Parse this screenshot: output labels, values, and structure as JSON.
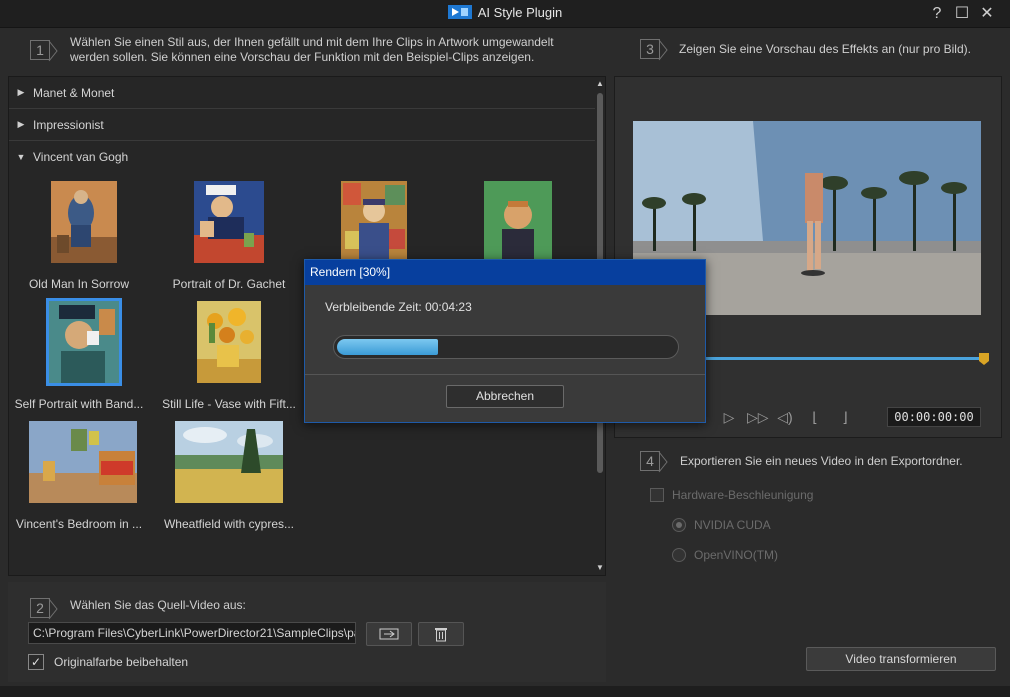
{
  "window": {
    "title": "AI Style Plugin",
    "help": "?",
    "maximize": "☐",
    "close": "✕"
  },
  "steps": {
    "s1": {
      "num": "1",
      "text": "Wählen Sie einen Stil aus, der Ihnen gefällt und mit dem Ihre Clips in Artwork umgewandelt werden sollen. Sie können eine Vorschau der Funktion mit den Beispiel-Clips anzeigen."
    },
    "s2": {
      "num": "2",
      "text": "Wählen Sie das Quell-Video aus:"
    },
    "s3": {
      "num": "3",
      "text": "Zeigen Sie eine Vorschau des Effekts an (nur pro Bild)."
    },
    "s4": {
      "num": "4",
      "text": "Exportieren Sie ein neues Video in den Exportordner."
    }
  },
  "categories": [
    {
      "label": "Manet & Monet",
      "arrow": "▶"
    },
    {
      "label": "Impressionist",
      "arrow": "▶"
    },
    {
      "label": "Vincent van Gogh",
      "arrow": "▼"
    }
  ],
  "styles": [
    {
      "label": "Old Man In Sorrow"
    },
    {
      "label": "Portrait of Dr. Gachet"
    },
    {
      "label": ""
    },
    {
      "label": ""
    },
    {
      "label": "Self Portrait with Band..."
    },
    {
      "label": "Still Life - Vase with Fift..."
    },
    {
      "label": "Vincent's Bedroom in ..."
    },
    {
      "label": "Wheatfield with cypres..."
    }
  ],
  "preview": {
    "timecode": "00:00:00:00"
  },
  "export": {
    "hw_accel": "Hardware-Beschleunigung",
    "opt1": "NVIDIA CUDA",
    "opt2": "OpenVINO(TM)",
    "transform_btn": "Video transformieren"
  },
  "source": {
    "path": "C:\\Program Files\\CyberLink\\PowerDirector21\\SampleClips\\pa",
    "keep_color": "Originalfarbe beibehalten"
  },
  "dialog": {
    "title": "Rendern [30%]",
    "remaining": "Verbleibende Zeit: 00:04:23",
    "progress": 0.3,
    "cancel": "Abbrechen"
  },
  "colors": {
    "accent": "#3a8ee6",
    "dialog_title_bg": "#073f9e",
    "progress": "#4aa8e0"
  }
}
